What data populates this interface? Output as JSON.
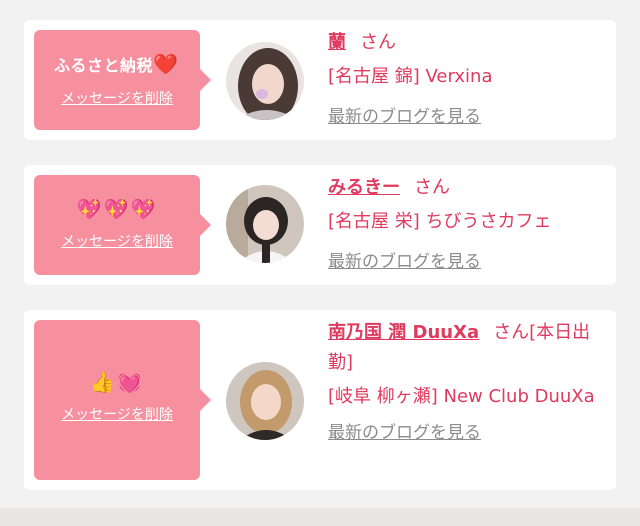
{
  "messages": [
    {
      "bubble_text": "ふるさと納税",
      "bubble_emoji": "❤️",
      "delete_label": "メッセージを削除",
      "name": "蘭",
      "suffix": "さん",
      "shop": "[名古屋 錦] Verxina",
      "blog_label": "最新のブログを見る"
    },
    {
      "bubble_text": "",
      "bubble_emoji": "💖💖💖",
      "delete_label": "メッセージを削除",
      "name": "みるきー",
      "suffix": "さん",
      "shop": "[名古屋 栄] ちびうさカフェ",
      "blog_label": "最新のブログを見る"
    },
    {
      "bubble_text": "",
      "bubble_emoji": "👍💓",
      "delete_label": "メッセージを削除",
      "name": "南乃国 潤 DuuXa",
      "suffix": "さん[本日出勤]",
      "shop": "[岐阜 柳ヶ瀬] New Club DuuXa",
      "blog_label": "最新のブログを見る"
    }
  ],
  "colors": {
    "bubble": "#f6909f",
    "name": "#e03a5e",
    "link_gray": "#8c8c8c",
    "background": "#f2f2f2"
  }
}
